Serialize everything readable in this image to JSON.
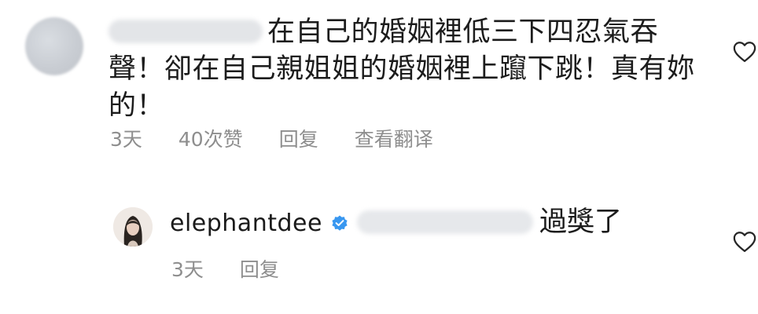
{
  "comments": [
    {
      "text_line1": "在自己的婚姻裡低三下四忍氣吞",
      "text_line2": "聲！卻在自己親姐姐的婚姻裡上躥下跳！真有妳",
      "text_line3": "的！",
      "time": "3天",
      "likes": "40次赞",
      "reply": "回复",
      "translate": "查看翻译",
      "like_icon": "heart-outline-icon"
    },
    {
      "username": "elephantdee",
      "verified_icon": "verified-badge-icon",
      "text": "過獎了",
      "time": "3天",
      "reply": "回复",
      "like_icon": "heart-outline-icon"
    }
  ],
  "colors": {
    "text": "#1c1c1c",
    "meta": "#8e8e8e",
    "verified": "#3897f0"
  }
}
